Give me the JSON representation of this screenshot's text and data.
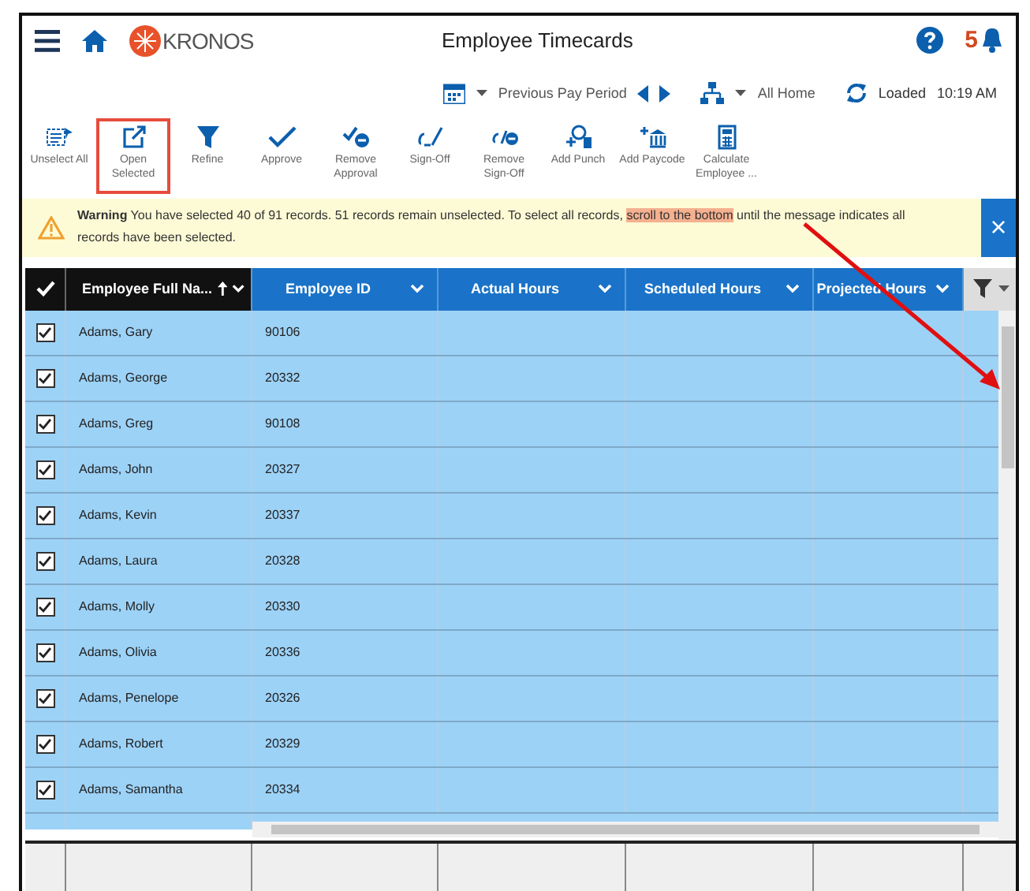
{
  "header": {
    "brand": "KRONOS",
    "title": "Employee Timecards",
    "notification_count": "5"
  },
  "period_bar": {
    "period": "Previous Pay Period",
    "location": "All Home",
    "status": "Loaded",
    "time": "10:19 AM"
  },
  "toolbar": [
    {
      "kind": "unselect",
      "label": "Unselect All",
      "highlighted": false
    },
    {
      "kind": "open",
      "label": "Open Selected",
      "highlighted": true
    },
    {
      "kind": "refine",
      "label": "Refine",
      "highlighted": false
    },
    {
      "kind": "approve",
      "label": "Approve",
      "highlighted": false
    },
    {
      "kind": "remove-approval",
      "label": "Remove Approval",
      "highlighted": false
    },
    {
      "kind": "signoff",
      "label": "Sign-Off",
      "highlighted": false
    },
    {
      "kind": "remove-signoff",
      "label": "Remove Sign-Off",
      "highlighted": false
    },
    {
      "kind": "punch",
      "label": "Add Punch",
      "highlighted": false
    },
    {
      "kind": "paycode",
      "label": "Add Paycode",
      "highlighted": false
    },
    {
      "kind": "calculate",
      "label": "Calculate Employee ...",
      "highlighted": false
    }
  ],
  "warning": {
    "label": "Warning",
    "before": "You have selected 40 of 91 records. 51 records remain unselected. To select all records, ",
    "highlight": "scroll to the bottom",
    "after": " until the message indicates all records have been selected.",
    "close": "×"
  },
  "table": {
    "columns": [
      {
        "label": "Employee Full Na...",
        "sorted": true
      },
      {
        "label": "Employee ID",
        "sorted": false
      },
      {
        "label": "Actual Hours",
        "sorted": false
      },
      {
        "label": "Scheduled Hours",
        "sorted": false
      },
      {
        "label": "Projected Hours",
        "sorted": false
      }
    ],
    "rows": [
      {
        "name": "Adams, Gary",
        "id": "90106",
        "checked": true
      },
      {
        "name": "Adams, George",
        "id": "20332",
        "checked": true
      },
      {
        "name": "Adams, Greg",
        "id": "90108",
        "checked": true
      },
      {
        "name": "Adams, John",
        "id": "20327",
        "checked": true
      },
      {
        "name": "Adams, Kevin",
        "id": "20337",
        "checked": true
      },
      {
        "name": "Adams, Laura",
        "id": "20328",
        "checked": true
      },
      {
        "name": "Adams, Molly",
        "id": "20330",
        "checked": true
      },
      {
        "name": "Adams, Olivia",
        "id": "20336",
        "checked": true
      },
      {
        "name": "Adams, Penelope",
        "id": "20326",
        "checked": true
      },
      {
        "name": "Adams, Robert",
        "id": "20329",
        "checked": true
      },
      {
        "name": "Adams, Samantha",
        "id": "20334",
        "checked": true
      }
    ]
  }
}
